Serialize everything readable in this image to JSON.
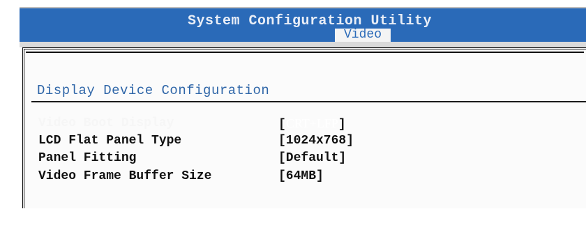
{
  "header": {
    "title": "System Configuration Utility",
    "active_tab": "Video"
  },
  "section": {
    "title": "Display Device Configuration"
  },
  "settings": [
    {
      "label": "Video Boot Display",
      "value_open": "[",
      "value": "CRT+LFP",
      "value_close": "]",
      "selected": true
    },
    {
      "label": "LCD Flat Panel Type",
      "value": "[1024x768]"
    },
    {
      "label": "Panel Fitting",
      "value": "[Default]"
    },
    {
      "label": "Video Frame Buffer Size",
      "value": "[64MB]"
    }
  ],
  "colors": {
    "header_bg": "#2a6ab8",
    "accent": "#2f66a8",
    "selected_text": "#ffffff"
  }
}
